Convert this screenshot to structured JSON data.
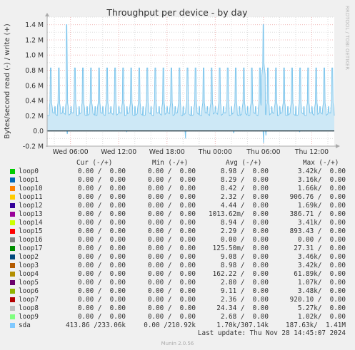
{
  "chart_data": {
    "type": "line",
    "title": "Throughput per device - by day",
    "ylabel": "Bytes/second read (-) / write (+)",
    "side_label": "RRDTOOL / TOBI OETIKER",
    "ylim": [
      -0.2,
      1.5
    ],
    "y_unit": "M",
    "y_ticks": [
      "1.4 M",
      "1.2 M",
      "1.0 M",
      "0.8 M",
      "0.6 M",
      "0.4 M",
      "0.2 M",
      "0.0",
      "-0.2 M"
    ],
    "x_ticks": [
      "Wed 06:00",
      "Wed 12:00",
      "Wed 18:00",
      "Thu 00:00",
      "Thu 06:00",
      "Thu 12:00"
    ],
    "x_range_hours": [
      3.1,
      38.8
    ],
    "colors": {
      "sda": "#7ac4ec",
      "grid_major": "#f0b8b8",
      "grid_minor": "#dddddd",
      "zero_line": "#000000",
      "background": "#f0f0f0",
      "plot_background": "#ffffff"
    },
    "series": [
      {
        "name": "sda",
        "write_baseline_M": 0.22,
        "write_spike_peak_M": 0.83,
        "write_spike_period_hours": 1,
        "write_large_spikes": [
          [
            5.5,
            1.4
          ],
          [
            30.0,
            1.4
          ]
        ],
        "read_small_dips": [
          [
            5.6,
            -0.04
          ],
          [
            13.0,
            -0.01
          ],
          [
            20.3,
            -0.1
          ],
          [
            26.3,
            -0.03
          ],
          [
            30.0,
            -0.16
          ],
          [
            30.3,
            -0.06
          ],
          [
            34.5,
            -0.01
          ]
        ]
      }
    ]
  },
  "legend": {
    "headers": {
      "cur": "Cur (-/+)",
      "min": "Min (-/+)",
      "avg": "Avg (-/+)",
      "max": "Max (-/+)"
    },
    "rows": [
      {
        "name": "loop0",
        "color": "#00cc00",
        "cur": "0.00 /  0.00",
        "min": "0.00 /  0.00",
        "avg": "8.98 /  0.00",
        "max": "3.42k/  0.00"
      },
      {
        "name": "loop1",
        "color": "#0066b3",
        "cur": "0.00 /  0.00",
        "min": "0.00 /  0.00",
        "avg": "8.29 /  0.00",
        "max": "3.16k/  0.00"
      },
      {
        "name": "loop10",
        "color": "#ff8000",
        "cur": "0.00 /  0.00",
        "min": "0.00 /  0.00",
        "avg": "8.42 /  0.00",
        "max": "1.66k/  0.00"
      },
      {
        "name": "loop11",
        "color": "#ffcc00",
        "cur": "0.00 /  0.00",
        "min": "0.00 /  0.00",
        "avg": "2.32 /  0.00",
        "max": "906.76 /  0.00"
      },
      {
        "name": "loop12",
        "color": "#330099",
        "cur": "0.00 /  0.00",
        "min": "0.00 /  0.00",
        "avg": "4.44 /  0.00",
        "max": "1.69k/  0.00"
      },
      {
        "name": "loop13",
        "color": "#990099",
        "cur": "0.00 /  0.00",
        "min": "0.00 /  0.00",
        "avg": "1013.62m/  0.00",
        "max": "386.71 /  0.00"
      },
      {
        "name": "loop14",
        "color": "#ccff00",
        "cur": "0.00 /  0.00",
        "min": "0.00 /  0.00",
        "avg": "8.94 /  0.00",
        "max": "3.41k/  0.00"
      },
      {
        "name": "loop15",
        "color": "#ff0000",
        "cur": "0.00 /  0.00",
        "min": "0.00 /  0.00",
        "avg": "2.29 /  0.00",
        "max": "893.43 /  0.00"
      },
      {
        "name": "loop16",
        "color": "#808080",
        "cur": "0.00 /  0.00",
        "min": "0.00 /  0.00",
        "avg": "0.00 /  0.00",
        "max": "0.00 /  0.00"
      },
      {
        "name": "loop17",
        "color": "#008f00",
        "cur": "0.00 /  0.00",
        "min": "0.00 /  0.00",
        "avg": "125.50m/  0.00",
        "max": "27.31 /  0.00"
      },
      {
        "name": "loop2",
        "color": "#00487d",
        "cur": "0.00 /  0.00",
        "min": "0.00 /  0.00",
        "avg": "9.08 /  0.00",
        "max": "3.46k/  0.00"
      },
      {
        "name": "loop3",
        "color": "#b35a00",
        "cur": "0.00 /  0.00",
        "min": "0.00 /  0.00",
        "avg": "8.98 /  0.00",
        "max": "3.42k/  0.00"
      },
      {
        "name": "loop4",
        "color": "#b38f00",
        "cur": "0.00 /  0.00",
        "min": "0.00 /  0.00",
        "avg": "162.22 /  0.00",
        "max": "61.89k/  0.00"
      },
      {
        "name": "loop5",
        "color": "#6b006b",
        "cur": "0.00 /  0.00",
        "min": "0.00 /  0.00",
        "avg": "2.80 /  0.00",
        "max": "1.07k/  0.00"
      },
      {
        "name": "loop6",
        "color": "#8fb300",
        "cur": "0.00 /  0.00",
        "min": "0.00 /  0.00",
        "avg": "9.11 /  0.00",
        "max": "3.48k/  0.00"
      },
      {
        "name": "loop7",
        "color": "#b30000",
        "cur": "0.00 /  0.00",
        "min": "0.00 /  0.00",
        "avg": "2.36 /  0.00",
        "max": "920.10 /  0.00"
      },
      {
        "name": "loop8",
        "color": "#bebebe",
        "cur": "0.00 /  0.00",
        "min": "0.00 /  0.00",
        "avg": "24.34 /  0.00",
        "max": "5.27k/  0.00"
      },
      {
        "name": "loop9",
        "color": "#80ff80",
        "cur": "0.00 /  0.00",
        "min": "0.00 /  0.00",
        "avg": "2.68 /  0.00",
        "max": "1.02k/  0.00"
      },
      {
        "name": "sda",
        "color": "#80c9ff",
        "cur": "413.86 /233.06k",
        "min": "0.00 /210.92k",
        "avg": "1.70k/307.14k",
        "max": "187.63k/  1.41M"
      }
    ]
  },
  "footer": {
    "last_update": "Last update: Thu Nov 28 14:45:07 2024",
    "version": "Munin 2.0.56"
  }
}
